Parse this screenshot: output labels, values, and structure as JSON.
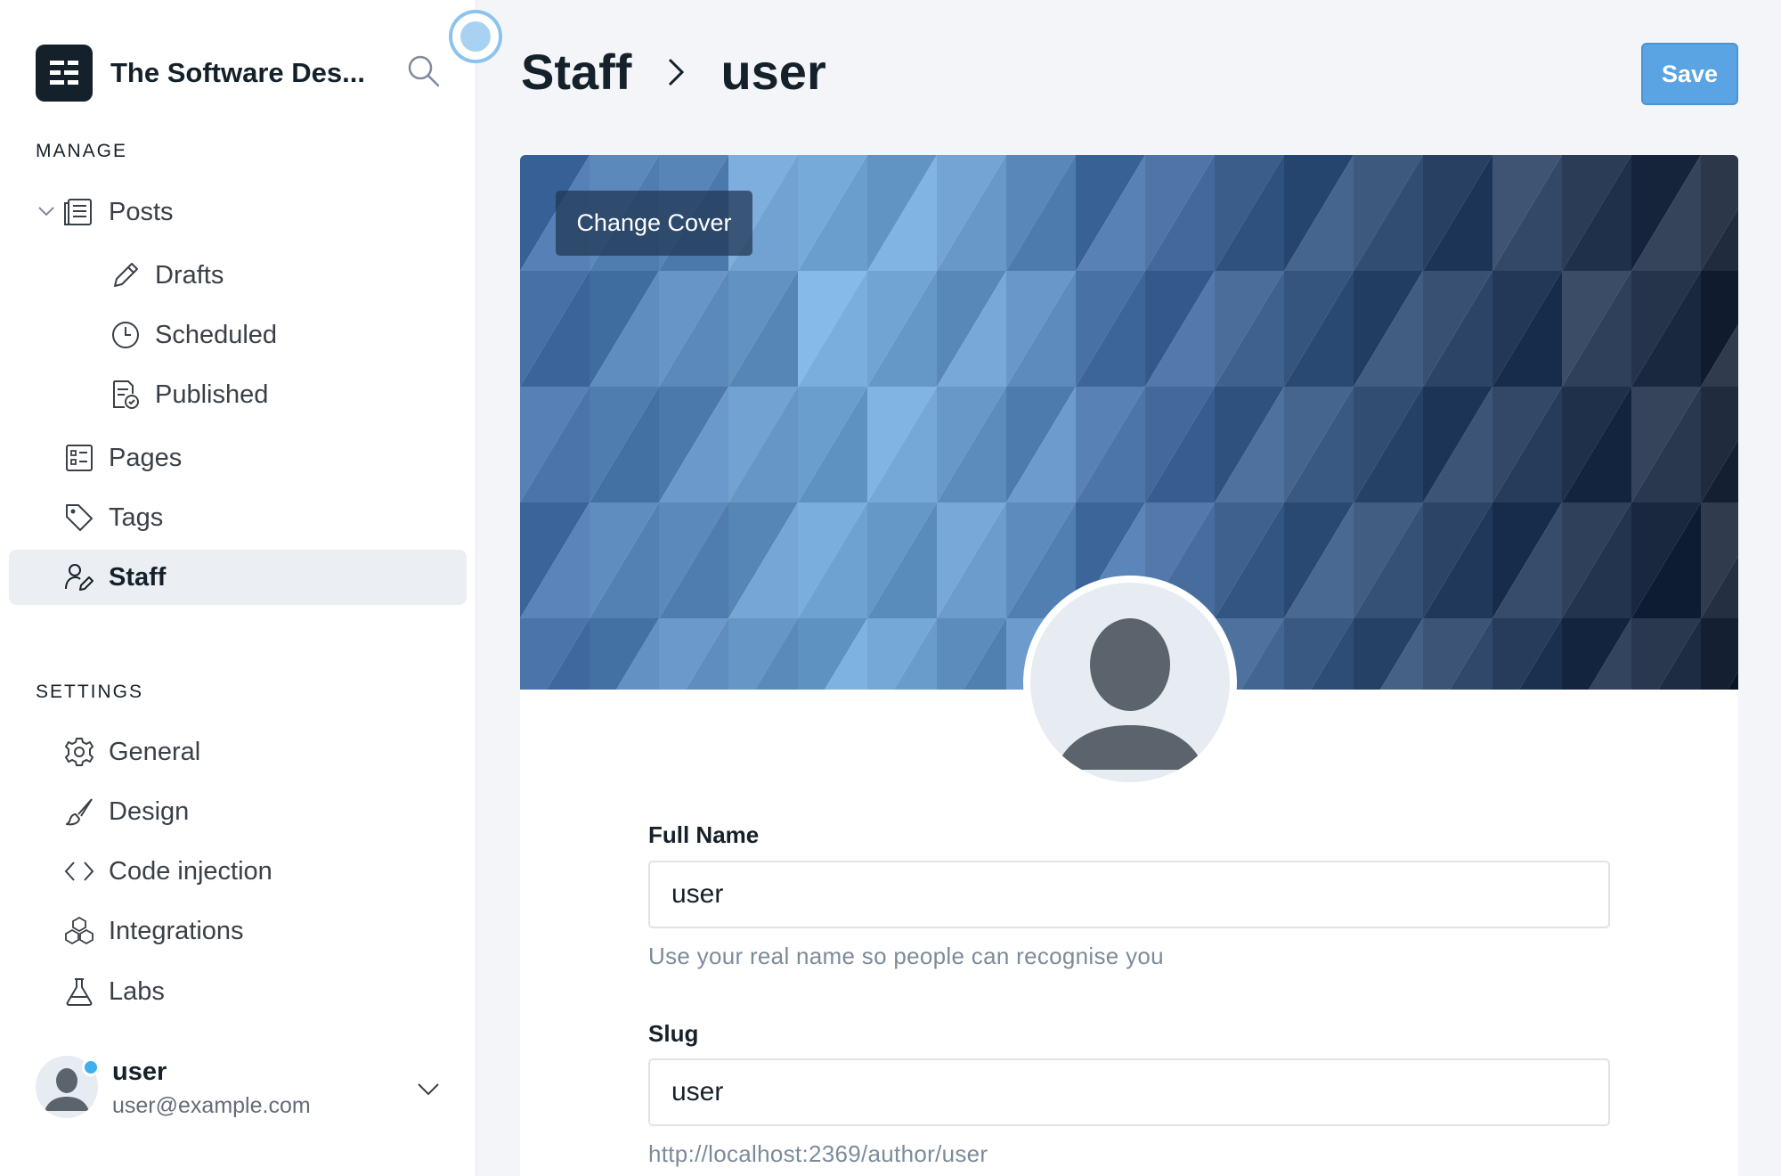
{
  "site": {
    "name": "The Software Des..."
  },
  "sidebar": {
    "manage_label": "MANAGE",
    "settings_label": "SETTINGS",
    "posts": "Posts",
    "drafts": "Drafts",
    "scheduled": "Scheduled",
    "published": "Published",
    "pages": "Pages",
    "tags": "Tags",
    "staff": "Staff",
    "general": "General",
    "design": "Design",
    "code_injection": "Code injection",
    "integrations": "Integrations",
    "labs": "Labs"
  },
  "current_user": {
    "name": "user",
    "email": "user@example.com"
  },
  "header": {
    "crumb_parent": "Staff",
    "crumb_current": "user",
    "save_label": "Save"
  },
  "cover": {
    "change_label": "Change Cover"
  },
  "form": {
    "full_name_label": "Full Name",
    "full_name_value": "user",
    "full_name_help": "Use your real name so people can recognise you",
    "slug_label": "Slug",
    "slug_value": "user",
    "slug_help": "http://localhost:2369/author/user"
  },
  "colors": {
    "accent": "#3eb0ef",
    "save": "#5aa4e4",
    "dark": "#15212a"
  }
}
